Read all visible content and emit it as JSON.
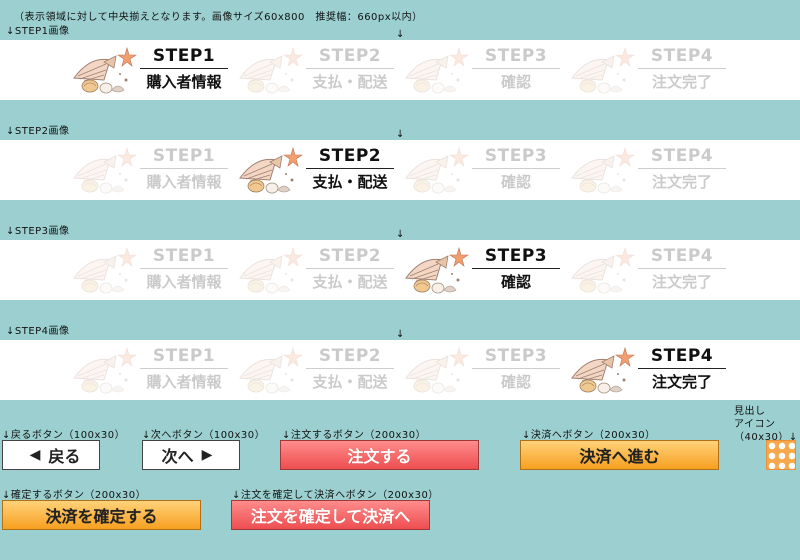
{
  "intro_note": "（表示領域に対して中央揃えとなります。画像サイズ60x800　推奨幅：660px以内）",
  "arrow_glyph": "↓",
  "sections": [
    {
      "label": "↓STEP1画像",
      "active": 0
    },
    {
      "label": "↓STEP2画像",
      "active": 1
    },
    {
      "label": "↓STEP3画像",
      "active": 2
    },
    {
      "label": "↓STEP4画像",
      "active": 3
    }
  ],
  "steps": [
    {
      "title": "STEP1",
      "name": "購入者情報"
    },
    {
      "title": "STEP2",
      "name": "支払・配送"
    },
    {
      "title": "STEP3",
      "name": "確認"
    },
    {
      "title": "STEP4",
      "name": "注文完了"
    }
  ],
  "buttons": {
    "back": {
      "note": "↓戻るボタン（100x30）",
      "label": "戻る",
      "icon": "◀"
    },
    "next": {
      "note": "↓次へボタン（100x30）",
      "label": "次へ",
      "icon": "▶"
    },
    "order": {
      "note": "↓注文するボタン（200x30）",
      "label": "注文する"
    },
    "pay": {
      "note": "↓決済へボタン（200x30）",
      "label": "決済へ進む"
    },
    "confirm_pay": {
      "note": "↓確定するボタン（200x30）",
      "label": "決済を確定する"
    },
    "confirm_order_pay": {
      "note": "↓注文を確定して決済へボタン（200x30）",
      "label": "注文を確定して決済へ"
    }
  },
  "heading_icon": {
    "note_line1": "見出し",
    "note_line2": "アイコン",
    "note_line3": "（40x30）↓",
    "icon": "heading-pattern-icon"
  },
  "colors": {
    "background": "#9cd0d0",
    "red_button": "#ee4e50",
    "orange_button": "#f7a020",
    "icon": "#f7a84a"
  }
}
